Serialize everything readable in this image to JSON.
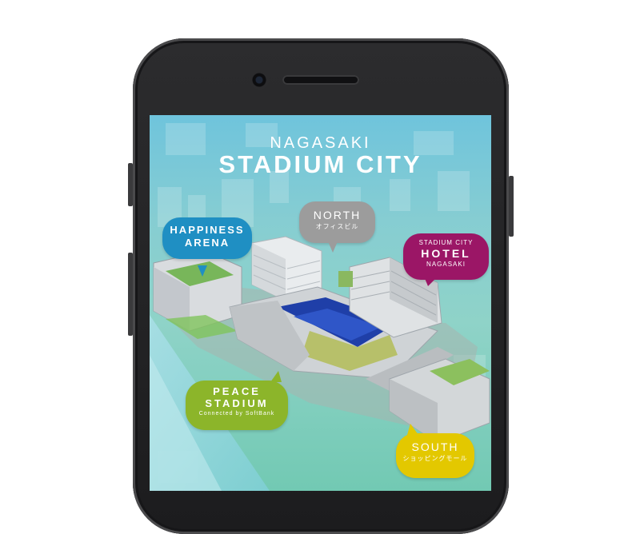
{
  "header": {
    "title_line1": "NAGASAKI",
    "title_line2": "STADIUM CITY"
  },
  "map_pins": {
    "happiness_arena": {
      "line1": "HAPPINESS",
      "line2": "ARENA",
      "color": "#1f8fc3"
    },
    "north": {
      "line1": "NORTH",
      "sub": "オフィスビル",
      "color": "#9c9c9c"
    },
    "hotel": {
      "top": "STADIUM CITY",
      "line1": "HOTEL",
      "bottom": "NAGASAKI",
      "color": "#9b1666"
    },
    "peace_stadium": {
      "line1": "PEACE",
      "line2": "STADIUM",
      "sub": "Connected by SoftBank",
      "color": "#8cb52a"
    },
    "south": {
      "line1": "SOUTH",
      "sub": "ショッピングモール",
      "color": "#e3c800"
    }
  }
}
